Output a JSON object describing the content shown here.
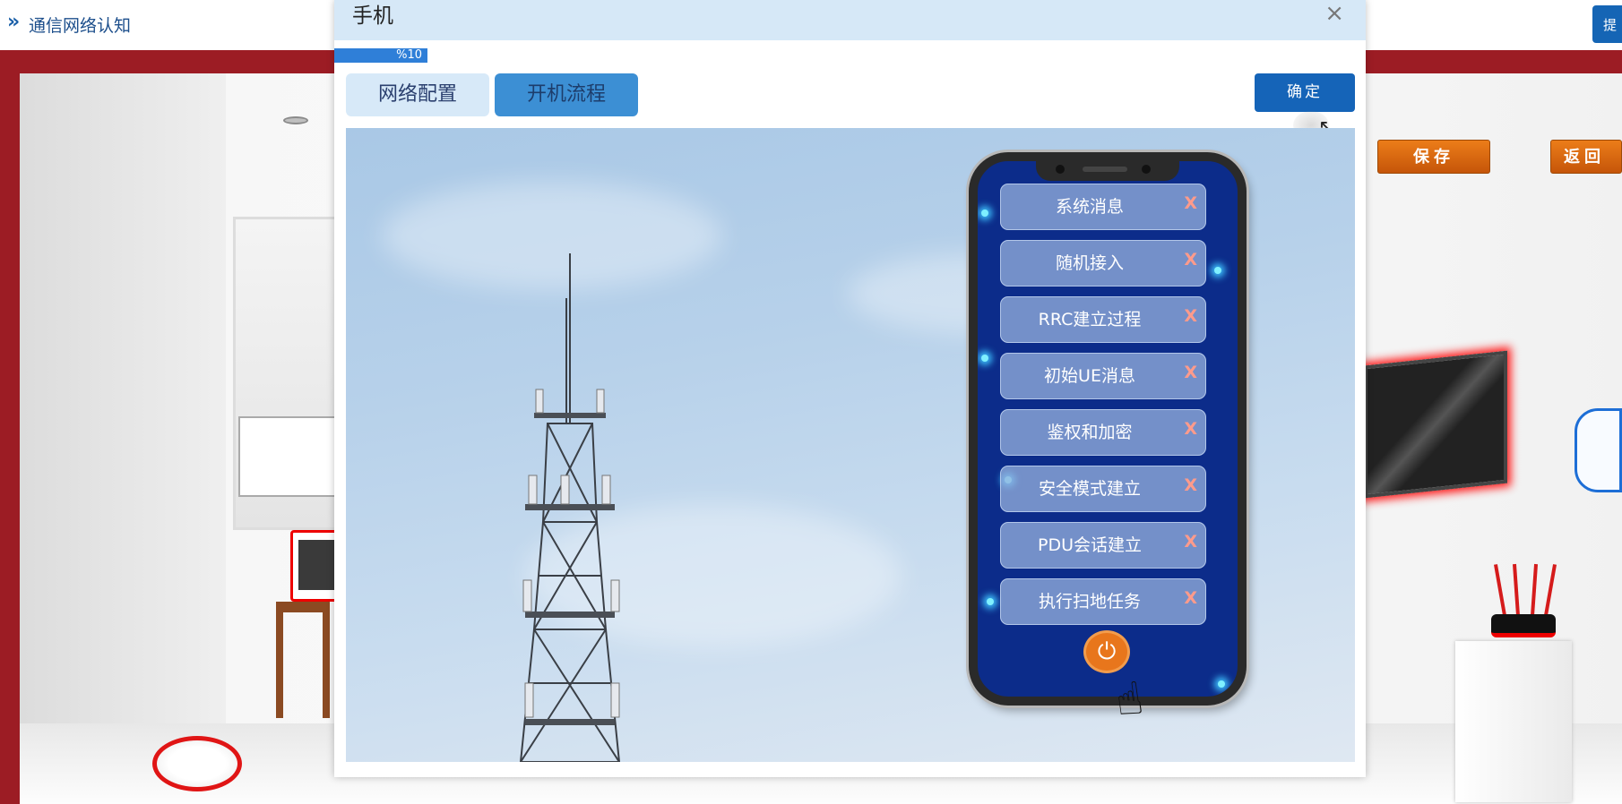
{
  "app": {
    "breadcrumb_icon": "»",
    "breadcrumb_title": "通信网络认知",
    "top_right_label": "提"
  },
  "scene": {
    "save_label": "保存",
    "back_label": "返回"
  },
  "modal": {
    "title": "手机",
    "close_icon": "×",
    "progress": {
      "text": "%10",
      "value_percent": 10
    },
    "tabs": [
      {
        "label": "网络配置",
        "active": false
      },
      {
        "label": "开机流程",
        "active": true
      }
    ],
    "confirm_label": "确定"
  },
  "phone": {
    "items": [
      {
        "label": "系统消息",
        "remove": "X"
      },
      {
        "label": "随机接入",
        "remove": "X"
      },
      {
        "label": "RRC建立过程",
        "remove": "X"
      },
      {
        "label": "初始UE消息",
        "remove": "X"
      },
      {
        "label": "鉴权和加密",
        "remove": "X"
      },
      {
        "label": "安全模式建立",
        "remove": "X"
      },
      {
        "label": "PDU会话建立",
        "remove": "X"
      },
      {
        "label": "执行扫地任务",
        "remove": "X"
      }
    ],
    "power_icon": "⏻"
  },
  "colors": {
    "accent": "#1564b8",
    "orange": "#e8761c",
    "brand_red": "#9c1c24"
  }
}
